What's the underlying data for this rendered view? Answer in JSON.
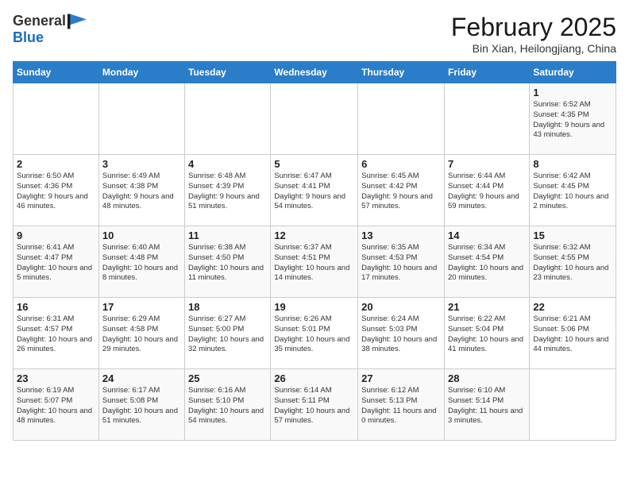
{
  "header": {
    "logo_general": "General",
    "logo_blue": "Blue",
    "month": "February 2025",
    "location": "Bin Xian, Heilongjiang, China"
  },
  "days_of_week": [
    "Sunday",
    "Monday",
    "Tuesday",
    "Wednesday",
    "Thursday",
    "Friday",
    "Saturday"
  ],
  "weeks": [
    [
      {
        "day": "",
        "info": ""
      },
      {
        "day": "",
        "info": ""
      },
      {
        "day": "",
        "info": ""
      },
      {
        "day": "",
        "info": ""
      },
      {
        "day": "",
        "info": ""
      },
      {
        "day": "",
        "info": ""
      },
      {
        "day": "1",
        "info": "Sunrise: 6:52 AM\nSunset: 4:35 PM\nDaylight: 9 hours and 43 minutes."
      }
    ],
    [
      {
        "day": "2",
        "info": "Sunrise: 6:50 AM\nSunset: 4:36 PM\nDaylight: 9 hours and 46 minutes."
      },
      {
        "day": "3",
        "info": "Sunrise: 6:49 AM\nSunset: 4:38 PM\nDaylight: 9 hours and 48 minutes."
      },
      {
        "day": "4",
        "info": "Sunrise: 6:48 AM\nSunset: 4:39 PM\nDaylight: 9 hours and 51 minutes."
      },
      {
        "day": "5",
        "info": "Sunrise: 6:47 AM\nSunset: 4:41 PM\nDaylight: 9 hours and 54 minutes."
      },
      {
        "day": "6",
        "info": "Sunrise: 6:45 AM\nSunset: 4:42 PM\nDaylight: 9 hours and 57 minutes."
      },
      {
        "day": "7",
        "info": "Sunrise: 6:44 AM\nSunset: 4:44 PM\nDaylight: 9 hours and 59 minutes."
      },
      {
        "day": "8",
        "info": "Sunrise: 6:42 AM\nSunset: 4:45 PM\nDaylight: 10 hours and 2 minutes."
      }
    ],
    [
      {
        "day": "9",
        "info": "Sunrise: 6:41 AM\nSunset: 4:47 PM\nDaylight: 10 hours and 5 minutes."
      },
      {
        "day": "10",
        "info": "Sunrise: 6:40 AM\nSunset: 4:48 PM\nDaylight: 10 hours and 8 minutes."
      },
      {
        "day": "11",
        "info": "Sunrise: 6:38 AM\nSunset: 4:50 PM\nDaylight: 10 hours and 11 minutes."
      },
      {
        "day": "12",
        "info": "Sunrise: 6:37 AM\nSunset: 4:51 PM\nDaylight: 10 hours and 14 minutes."
      },
      {
        "day": "13",
        "info": "Sunrise: 6:35 AM\nSunset: 4:53 PM\nDaylight: 10 hours and 17 minutes."
      },
      {
        "day": "14",
        "info": "Sunrise: 6:34 AM\nSunset: 4:54 PM\nDaylight: 10 hours and 20 minutes."
      },
      {
        "day": "15",
        "info": "Sunrise: 6:32 AM\nSunset: 4:55 PM\nDaylight: 10 hours and 23 minutes."
      }
    ],
    [
      {
        "day": "16",
        "info": "Sunrise: 6:31 AM\nSunset: 4:57 PM\nDaylight: 10 hours and 26 minutes."
      },
      {
        "day": "17",
        "info": "Sunrise: 6:29 AM\nSunset: 4:58 PM\nDaylight: 10 hours and 29 minutes."
      },
      {
        "day": "18",
        "info": "Sunrise: 6:27 AM\nSunset: 5:00 PM\nDaylight: 10 hours and 32 minutes."
      },
      {
        "day": "19",
        "info": "Sunrise: 6:26 AM\nSunset: 5:01 PM\nDaylight: 10 hours and 35 minutes."
      },
      {
        "day": "20",
        "info": "Sunrise: 6:24 AM\nSunset: 5:03 PM\nDaylight: 10 hours and 38 minutes."
      },
      {
        "day": "21",
        "info": "Sunrise: 6:22 AM\nSunset: 5:04 PM\nDaylight: 10 hours and 41 minutes."
      },
      {
        "day": "22",
        "info": "Sunrise: 6:21 AM\nSunset: 5:06 PM\nDaylight: 10 hours and 44 minutes."
      }
    ],
    [
      {
        "day": "23",
        "info": "Sunrise: 6:19 AM\nSunset: 5:07 PM\nDaylight: 10 hours and 48 minutes."
      },
      {
        "day": "24",
        "info": "Sunrise: 6:17 AM\nSunset: 5:08 PM\nDaylight: 10 hours and 51 minutes."
      },
      {
        "day": "25",
        "info": "Sunrise: 6:16 AM\nSunset: 5:10 PM\nDaylight: 10 hours and 54 minutes."
      },
      {
        "day": "26",
        "info": "Sunrise: 6:14 AM\nSunset: 5:11 PM\nDaylight: 10 hours and 57 minutes."
      },
      {
        "day": "27",
        "info": "Sunrise: 6:12 AM\nSunset: 5:13 PM\nDaylight: 11 hours and 0 minutes."
      },
      {
        "day": "28",
        "info": "Sunrise: 6:10 AM\nSunset: 5:14 PM\nDaylight: 11 hours and 3 minutes."
      },
      {
        "day": "",
        "info": ""
      }
    ]
  ]
}
